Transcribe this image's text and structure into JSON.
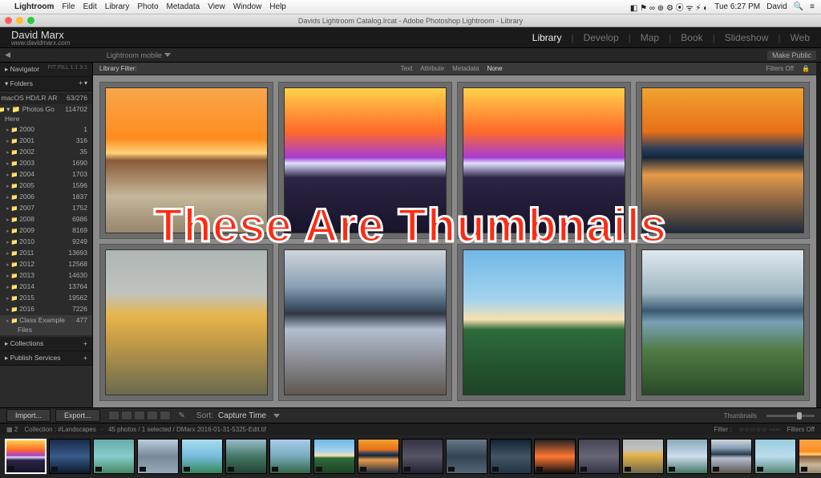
{
  "menubar": {
    "app": "Lightroom",
    "items": [
      "File",
      "Edit",
      "Library",
      "Photo",
      "Metadata",
      "View",
      "Window",
      "Help"
    ],
    "clock": "Tue 6:27 PM",
    "user": "David"
  },
  "window": {
    "title": "Davids Lightroom Catalog.lrcat - Adobe Photoshop Lightroom - Library"
  },
  "identity": {
    "name": "David Marx",
    "url": "www.davidmarx.com"
  },
  "modules": [
    "Library",
    "Develop",
    "Map",
    "Book",
    "Slideshow",
    "Web"
  ],
  "active_module": "Library",
  "secbar": {
    "mobile": "Lightroom mobile",
    "makepublic": "Make Public"
  },
  "side": {
    "navigator": "Navigator",
    "folders_hdr": "Folders",
    "root": {
      "name": "macOS HD/LR AR",
      "count": "63/276"
    },
    "parent": {
      "name": "Photos Go Here",
      "count": "114702"
    },
    "years": [
      {
        "name": "2000",
        "count": "1"
      },
      {
        "name": "2001",
        "count": "316"
      },
      {
        "name": "2002",
        "count": "35"
      },
      {
        "name": "2003",
        "count": "1690"
      },
      {
        "name": "2004",
        "count": "1703"
      },
      {
        "name": "2005",
        "count": "1596"
      },
      {
        "name": "2006",
        "count": "1837"
      },
      {
        "name": "2007",
        "count": "1752"
      },
      {
        "name": "2008",
        "count": "6986"
      },
      {
        "name": "2009",
        "count": "8169"
      },
      {
        "name": "2010",
        "count": "9249"
      },
      {
        "name": "2011",
        "count": "13693"
      },
      {
        "name": "2012",
        "count": "12568"
      },
      {
        "name": "2013",
        "count": "14630"
      },
      {
        "name": "2014",
        "count": "13764"
      },
      {
        "name": "2015",
        "count": "19562"
      },
      {
        "name": "2016",
        "count": "7226"
      },
      {
        "name": "Class Example Files",
        "count": "477"
      }
    ],
    "collections": "Collections",
    "publish": "Publish Services"
  },
  "filter": {
    "label": "Library Filter:",
    "tabs": [
      "Text",
      "Attribute",
      "Metadata",
      "None"
    ],
    "off": "Filters Off"
  },
  "toolbar": {
    "import": "Import...",
    "export": "Export...",
    "sort": "Sort:",
    "sortval": "Capture Time",
    "thumbnails_lbl": "Thumbnails"
  },
  "info": {
    "coll": "Collection : #Landscapes",
    "sel": "45 photos / 1 selected / DMarx 2016-01-31-5325-Edit.tif",
    "filter": "Filter :",
    "foff": "Filters Off"
  },
  "overlay": "These Are Thumbnails"
}
